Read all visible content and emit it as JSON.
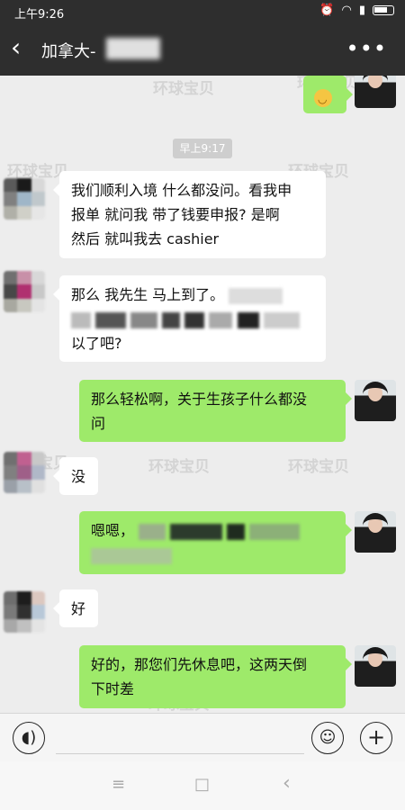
{
  "status_bar": {
    "time": "上午9:26",
    "right_icons": [
      "alarm-icon",
      "wifi-icon",
      "signal-icon",
      "battery-icon"
    ]
  },
  "header": {
    "contact_name": "加拿大-",
    "back_icon": "‹",
    "more_icon": "•••"
  },
  "timestamp": "早上9:17",
  "messages": [
    {
      "side": "right",
      "type": "emoji",
      "text": ""
    },
    {
      "side": "left",
      "text_lines": [
        "我们顺利入境 什么都没问。看我申",
        "报单 就问我 带了钱要申报? 是啊",
        "然后 就叫我去 cashier"
      ]
    },
    {
      "side": "left",
      "line1": "那么 我先生 马上到了。",
      "line3": "以了吧?"
    },
    {
      "side": "right",
      "text_lines": [
        "那么轻松啊，关于生孩子什么都没",
        "问"
      ]
    },
    {
      "side": "left",
      "text": "没"
    },
    {
      "side": "right",
      "text_prefix": "嗯嗯，"
    },
    {
      "side": "left",
      "text": "好"
    },
    {
      "side": "right",
      "text_lines": [
        "好的，那您们先休息吧，这两天倒",
        "下时差"
      ]
    }
  ],
  "watermark_text": "环球宝贝",
  "colors": {
    "header_bg": "#2e2e2e",
    "self_bubble": "#9eea6a",
    "other_bubble": "#ffffff",
    "chat_bg": "#ededed"
  },
  "input_bar": {
    "voice_icon": "voice-icon",
    "emoji_icon": "emoji-icon",
    "plus_icon": "+"
  },
  "nav_bar": {
    "menu": "≡",
    "home": "□",
    "back": "‹"
  }
}
